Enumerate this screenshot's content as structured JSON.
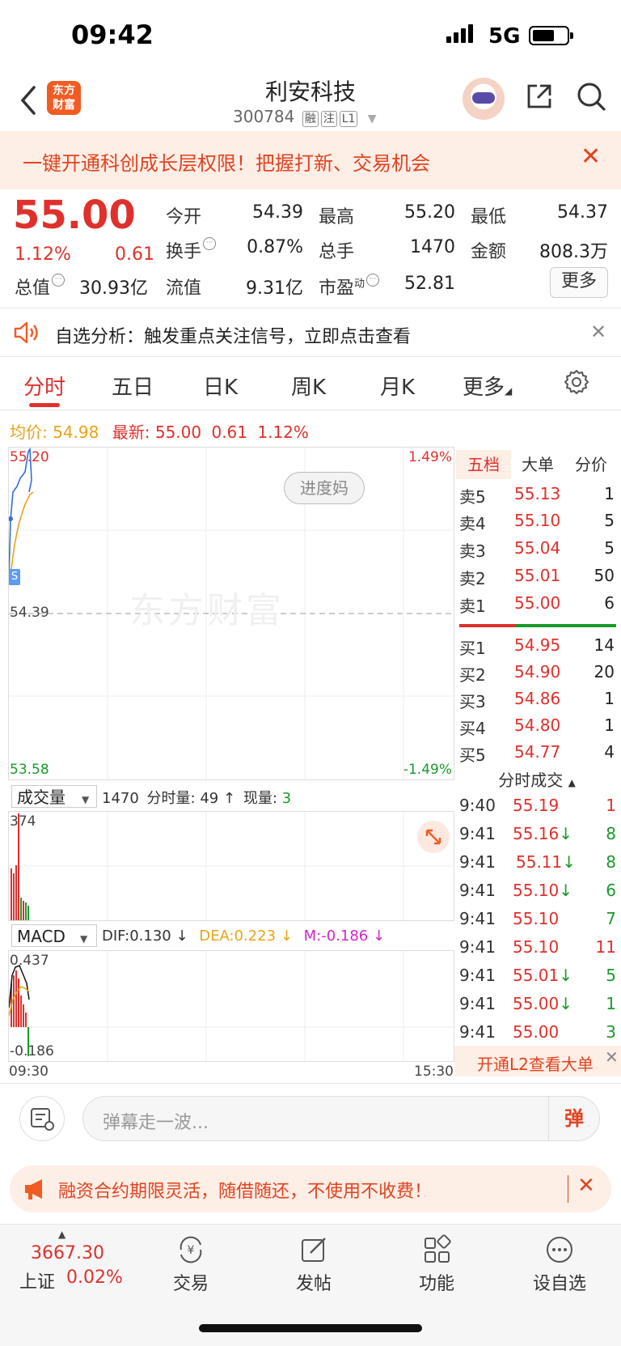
{
  "status_bar": {
    "time": "09:42",
    "network": "5G"
  },
  "header": {
    "logo_text_1": "东方",
    "logo_text_2": "财富",
    "stock_name": "利安科技",
    "stock_code": "300784",
    "tags": [
      "融",
      "注",
      "L1"
    ]
  },
  "banner": {
    "text": "一键开通科创成长层权限！把握打新、交易机会"
  },
  "quote": {
    "price": "55.00",
    "change_pct": "1.12%",
    "change": "0.61",
    "open_label": "今开",
    "open": "54.39",
    "high_label": "最高",
    "high": "55.20",
    "low_label": "最低",
    "low": "54.37",
    "turnover_label": "换手",
    "turnover": "0.87%",
    "volume_label": "总手",
    "volume": "1470",
    "amount_label": "金额",
    "amount": "808.3万",
    "mktcap_label": "总值",
    "mktcap": "30.93亿",
    "float_label": "流值",
    "float_cap": "9.31亿",
    "pe_label": "市盈",
    "pe_sup": "动",
    "pe": "52.81",
    "more_label": "更多"
  },
  "analysis": {
    "text": "自选分析：触发重点关注信号，立即点击查看"
  },
  "tabs": [
    "分时",
    "五日",
    "日K",
    "周K",
    "月K",
    "更多"
  ],
  "info_line": {
    "avg_label": "均价:",
    "avg": "54.98",
    "latest_label": "最新:",
    "latest": "55.00",
    "change": "0.61",
    "change_pct": "1.12%"
  },
  "chart": {
    "watermark": "东方财富",
    "button": "进度妈",
    "y_top": "55.20",
    "y_mid": "54.39",
    "y_bot": "53.58",
    "pct_top": "1.49%",
    "pct_bot": "-1.49%",
    "time_start": "09:30",
    "time_end": "15:30",
    "marker": "S"
  },
  "order_book": {
    "tabs": [
      "五档",
      "大单",
      "分价"
    ],
    "sells": [
      {
        "label": "卖5",
        "price": "55.13",
        "vol": "1"
      },
      {
        "label": "卖4",
        "price": "55.10",
        "vol": "5"
      },
      {
        "label": "卖3",
        "price": "55.04",
        "vol": "5"
      },
      {
        "label": "卖2",
        "price": "55.01",
        "vol": "50"
      },
      {
        "label": "卖1",
        "price": "55.00",
        "vol": "6"
      }
    ],
    "buys": [
      {
        "label": "买1",
        "price": "54.95",
        "vol": "14"
      },
      {
        "label": "买2",
        "price": "54.90",
        "vol": "20"
      },
      {
        "label": "买3",
        "price": "54.86",
        "vol": "1"
      },
      {
        "label": "买4",
        "price": "54.80",
        "vol": "1"
      },
      {
        "label": "买5",
        "price": "54.77",
        "vol": "4"
      }
    ],
    "ticks_header": "分时成交",
    "ticks": [
      {
        "time": "9:40",
        "price": "55.19",
        "arrow": "",
        "vol": "1",
        "side": "buy"
      },
      {
        "time": "9:41",
        "price": "55.16",
        "arrow": "↓",
        "vol": "8",
        "side": "sell"
      },
      {
        "time": "9:41",
        "price": "55.11",
        "arrow": "↓",
        "vol": "8",
        "side": "sell"
      },
      {
        "time": "9:41",
        "price": "55.10",
        "arrow": "↓",
        "vol": "6",
        "side": "sell"
      },
      {
        "time": "9:41",
        "price": "55.10",
        "arrow": "",
        "vol": "7",
        "side": "sell"
      },
      {
        "time": "9:41",
        "price": "55.10",
        "arrow": "",
        "vol": "11",
        "side": "buy"
      },
      {
        "time": "9:41",
        "price": "55.01",
        "arrow": "↓",
        "vol": "5",
        "side": "sell"
      },
      {
        "time": "9:41",
        "price": "55.00",
        "arrow": "↓",
        "vol": "1",
        "side": "sell"
      },
      {
        "time": "9:41",
        "price": "55.00",
        "arrow": "",
        "vol": "3",
        "side": "sell"
      }
    ],
    "l2_text": "开通L2查看大单"
  },
  "volume_panel": {
    "selector": "成交量",
    "total": "1470",
    "period_label": "分时量:",
    "period_vol": "49",
    "arrow": "↑",
    "current_label": "现量:",
    "current": "3",
    "max_label": "374"
  },
  "macd_panel": {
    "selector": "MACD",
    "dif": "DIF:0.130 ↓",
    "dea": "DEA:0.223 ↓",
    "m": "M:-0.186 ↓",
    "top": "0.437",
    "bot": "-0.186"
  },
  "danmu": {
    "placeholder": "弹幕走一波...",
    "send": "弹"
  },
  "promo": {
    "text": "融资合约期限灵活，随借随还，不使用不收费！"
  },
  "bottom_nav": {
    "index_value": "3667.30",
    "index_name": "上证",
    "index_pct": "0.02%",
    "items": [
      "交易",
      "发帖",
      "功能",
      "设自选"
    ]
  },
  "colors": {
    "up": "#e0302c",
    "down": "#1a9a2a",
    "accent": "#f25b22",
    "avg_line": "#e8a417",
    "price_line": "#2e6fd6"
  }
}
